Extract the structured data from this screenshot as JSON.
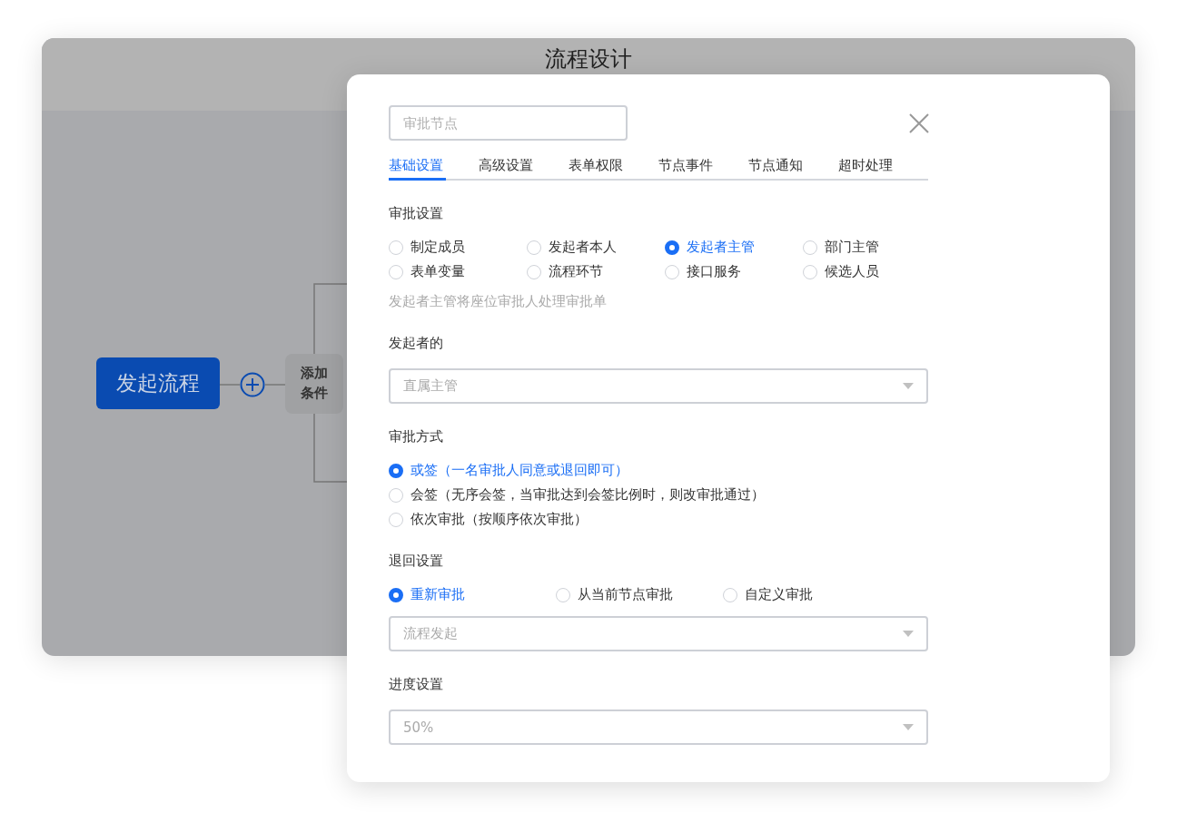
{
  "window": {
    "title": "流程设计"
  },
  "canvas": {
    "start_node": "发起流程",
    "add_condition_node": "添加条件"
  },
  "panel": {
    "name_field": {
      "placeholder": "审批节点"
    },
    "tabs": [
      {
        "label": "基础设置",
        "selected": true
      },
      {
        "label": "高级设置",
        "selected": false
      },
      {
        "label": "表单权限",
        "selected": false
      },
      {
        "label": "节点事件",
        "selected": false
      },
      {
        "label": "节点通知",
        "selected": false
      },
      {
        "label": "超时处理",
        "selected": false
      }
    ],
    "sections": [
      {
        "kind": "grid",
        "label": "审批设置",
        "options": [
          {
            "label": "制定成员",
            "selected": false
          },
          {
            "label": "发起者本人",
            "selected": false
          },
          {
            "label": "发起者主管",
            "selected": true
          },
          {
            "label": "部门主管",
            "selected": false
          },
          {
            "label": "表单变量",
            "selected": false
          },
          {
            "label": "流程环节",
            "selected": false
          },
          {
            "label": "接口服务",
            "selected": false
          },
          {
            "label": "候选人员",
            "selected": false
          }
        ],
        "hint": "发起者主管将座位审批人处理审批单"
      },
      {
        "kind": "select",
        "label": "发起者的",
        "select": {
          "value": "直属主管"
        }
      },
      {
        "kind": "list",
        "label": "审批方式",
        "options": [
          {
            "label": "或签（一名审批人同意或退回即可）",
            "selected": true
          },
          {
            "label": "会签（无序会签，当审批达到会签比例时，则改审批通过）",
            "selected": false
          },
          {
            "label": "依次审批（按顺序依次审批）",
            "selected": false
          }
        ]
      },
      {
        "kind": "row",
        "label": "退回设置",
        "options": [
          {
            "label": "重新审批",
            "selected": true
          },
          {
            "label": "从当前节点审批",
            "selected": false
          },
          {
            "label": "自定义审批",
            "selected": false
          }
        ],
        "select": {
          "value": "流程发起"
        }
      },
      {
        "kind": "select",
        "label": "进度设置",
        "select": {
          "value": "50%"
        }
      }
    ]
  }
}
